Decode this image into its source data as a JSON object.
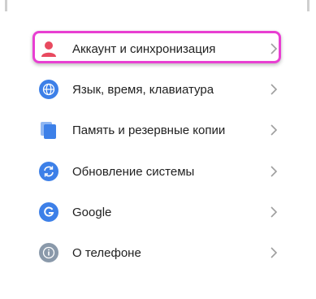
{
  "settings": {
    "items": [
      {
        "label": "Аккаунт и синхронизация",
        "icon": "account-icon",
        "color": "#e84a5f"
      },
      {
        "label": "Язык, время, клавиатура",
        "icon": "globe-icon",
        "color": "#3d80e8"
      },
      {
        "label": "Память и резервные копии",
        "icon": "storage-icon",
        "color": "#3d80e8"
      },
      {
        "label": "Обновление системы",
        "icon": "system-update-icon",
        "color": "#3d80e8"
      },
      {
        "label": "Google",
        "icon": "google-icon",
        "color": "#3d80e8"
      },
      {
        "label": "О телефоне",
        "icon": "info-icon",
        "color": "#8a99aa"
      }
    ]
  },
  "colors": {
    "highlight": "#e83fd2",
    "chevron": "#9e9e9e",
    "text": "#212121"
  }
}
